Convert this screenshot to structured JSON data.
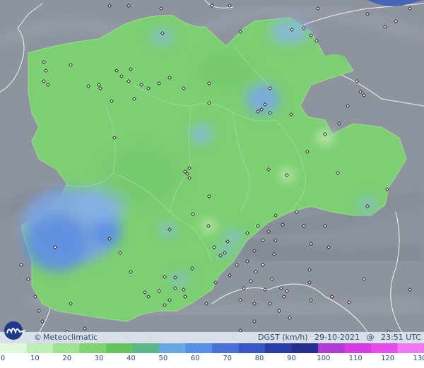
{
  "brand": {
    "copyright": "©",
    "name": "Meteoclimatic",
    "logo_icon": "meteoclimatic-logo-icon"
  },
  "product": {
    "variable": "DGST (km/h)",
    "date": "29-10-2021",
    "at": "@",
    "time": "23:51 UTC"
  },
  "legend": {
    "ticks": [
      "0",
      "10",
      "20",
      "30",
      "40",
      "50",
      "60",
      "70",
      "80",
      "90",
      "100",
      "110",
      "120",
      "130"
    ],
    "colors": [
      "#dff8dc",
      "#bfeeb6",
      "#a0e293",
      "#7fd372",
      "#66c45f",
      "#5cb68a",
      "#6aa8e0",
      "#5a8fe6",
      "#4a72d6",
      "#3a57c4",
      "#2a3ea8",
      "#26308c",
      "#b03cd0",
      "#d23ce0",
      "#e84ce8",
      "#f078f0"
    ]
  },
  "map": {
    "background_color": "#8e949e",
    "region_color": "#7ccf72",
    "markers_icon": "station-marker-icon"
  }
}
